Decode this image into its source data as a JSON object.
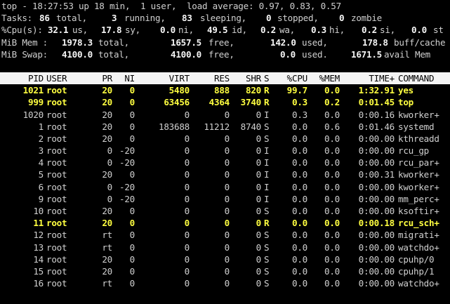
{
  "summary": {
    "line1": "top - 18:27:53 up 18 min,  1 user,  load average: 0.97, 0.83, 0.57",
    "tasks": {
      "label": "Tasks:",
      "total": "86",
      "total_lbl": "total,",
      "running": "3",
      "running_lbl": "running,",
      "sleeping": "83",
      "sleeping_lbl": "sleeping,",
      "stopped": "0",
      "stopped_lbl": "stopped,",
      "zombie": "0",
      "zombie_lbl": "zombie"
    },
    "cpu": {
      "label": "%Cpu(s):",
      "us": "32.1",
      "us_lbl": "us,",
      "sy": "17.8",
      "sy_lbl": "sy,",
      "ni": "0.0",
      "ni_lbl": "ni,",
      "id": "49.5",
      "id_lbl": "id,",
      "wa": "0.2",
      "wa_lbl": "wa,",
      "hi": "0.3",
      "hi_lbl": "hi,",
      "si": "0.2",
      "si_lbl": "si,",
      "st": "0.0",
      "st_lbl": "st"
    },
    "mem": {
      "label": "MiB Mem :",
      "total": "1978.3",
      "total_lbl": "total,",
      "free": "1657.5",
      "free_lbl": "free,",
      "used": "142.0",
      "used_lbl": "used,",
      "buff": "178.8",
      "buff_lbl": "buff/cache"
    },
    "swap": {
      "label": "MiB Swap:",
      "total": "4100.0",
      "total_lbl": "total,",
      "free": "4100.0",
      "free_lbl": "free,",
      "used": "0.0",
      "used_lbl": "used.",
      "avail": "1671.5",
      "avail_lbl": "avail Mem"
    }
  },
  "columns": [
    "PID",
    "USER",
    "PR",
    "NI",
    "VIRT",
    "RES",
    "SHR",
    "S",
    "%CPU",
    "%MEM",
    "TIME+",
    "COMMAND"
  ],
  "processes": [
    {
      "pid": "1021",
      "user": "root",
      "pr": "20",
      "ni": "0",
      "virt": "5480",
      "res": "888",
      "shr": "820",
      "s": "R",
      "cpu": "99.7",
      "mem": "0.0",
      "time": "1:32.91",
      "cmd": "yes",
      "hot": true
    },
    {
      "pid": "999",
      "user": "root",
      "pr": "20",
      "ni": "0",
      "virt": "63456",
      "res": "4364",
      "shr": "3740",
      "s": "R",
      "cpu": "0.3",
      "mem": "0.2",
      "time": "0:01.45",
      "cmd": "top",
      "hot": true
    },
    {
      "pid": "1020",
      "user": "root",
      "pr": "20",
      "ni": "0",
      "virt": "0",
      "res": "0",
      "shr": "0",
      "s": "I",
      "cpu": "0.3",
      "mem": "0.0",
      "time": "0:00.16",
      "cmd": "kworker+",
      "hot": false
    },
    {
      "pid": "1",
      "user": "root",
      "pr": "20",
      "ni": "0",
      "virt": "183688",
      "res": "11212",
      "shr": "8740",
      "s": "S",
      "cpu": "0.0",
      "mem": "0.6",
      "time": "0:01.46",
      "cmd": "systemd",
      "hot": false
    },
    {
      "pid": "2",
      "user": "root",
      "pr": "20",
      "ni": "0",
      "virt": "0",
      "res": "0",
      "shr": "0",
      "s": "S",
      "cpu": "0.0",
      "mem": "0.0",
      "time": "0:00.00",
      "cmd": "kthreadd",
      "hot": false
    },
    {
      "pid": "3",
      "user": "root",
      "pr": "0",
      "ni": "-20",
      "virt": "0",
      "res": "0",
      "shr": "0",
      "s": "I",
      "cpu": "0.0",
      "mem": "0.0",
      "time": "0:00.00",
      "cmd": "rcu_gp",
      "hot": false
    },
    {
      "pid": "4",
      "user": "root",
      "pr": "0",
      "ni": "-20",
      "virt": "0",
      "res": "0",
      "shr": "0",
      "s": "I",
      "cpu": "0.0",
      "mem": "0.0",
      "time": "0:00.00",
      "cmd": "rcu_par+",
      "hot": false
    },
    {
      "pid": "5",
      "user": "root",
      "pr": "20",
      "ni": "0",
      "virt": "0",
      "res": "0",
      "shr": "0",
      "s": "I",
      "cpu": "0.0",
      "mem": "0.0",
      "time": "0:00.31",
      "cmd": "kworker+",
      "hot": false
    },
    {
      "pid": "6",
      "user": "root",
      "pr": "0",
      "ni": "-20",
      "virt": "0",
      "res": "0",
      "shr": "0",
      "s": "I",
      "cpu": "0.0",
      "mem": "0.0",
      "time": "0:00.00",
      "cmd": "kworker+",
      "hot": false
    },
    {
      "pid": "9",
      "user": "root",
      "pr": "0",
      "ni": "-20",
      "virt": "0",
      "res": "0",
      "shr": "0",
      "s": "I",
      "cpu": "0.0",
      "mem": "0.0",
      "time": "0:00.00",
      "cmd": "mm_perc+",
      "hot": false
    },
    {
      "pid": "10",
      "user": "root",
      "pr": "20",
      "ni": "0",
      "virt": "0",
      "res": "0",
      "shr": "0",
      "s": "S",
      "cpu": "0.0",
      "mem": "0.0",
      "time": "0:00.00",
      "cmd": "ksoftir+",
      "hot": false
    },
    {
      "pid": "11",
      "user": "root",
      "pr": "20",
      "ni": "0",
      "virt": "0",
      "res": "0",
      "shr": "0",
      "s": "R",
      "cpu": "0.0",
      "mem": "0.0",
      "time": "0:00.18",
      "cmd": "rcu_sch+",
      "hot": true
    },
    {
      "pid": "12",
      "user": "root",
      "pr": "rt",
      "ni": "0",
      "virt": "0",
      "res": "0",
      "shr": "0",
      "s": "S",
      "cpu": "0.0",
      "mem": "0.0",
      "time": "0:00.00",
      "cmd": "migrati+",
      "hot": false
    },
    {
      "pid": "13",
      "user": "root",
      "pr": "rt",
      "ni": "0",
      "virt": "0",
      "res": "0",
      "shr": "0",
      "s": "S",
      "cpu": "0.0",
      "mem": "0.0",
      "time": "0:00.00",
      "cmd": "watchdo+",
      "hot": false
    },
    {
      "pid": "14",
      "user": "root",
      "pr": "20",
      "ni": "0",
      "virt": "0",
      "res": "0",
      "shr": "0",
      "s": "S",
      "cpu": "0.0",
      "mem": "0.0",
      "time": "0:00.00",
      "cmd": "cpuhp/0",
      "hot": false
    },
    {
      "pid": "15",
      "user": "root",
      "pr": "20",
      "ni": "0",
      "virt": "0",
      "res": "0",
      "shr": "0",
      "s": "S",
      "cpu": "0.0",
      "mem": "0.0",
      "time": "0:00.00",
      "cmd": "cpuhp/1",
      "hot": false
    },
    {
      "pid": "16",
      "user": "root",
      "pr": "rt",
      "ni": "0",
      "virt": "0",
      "res": "0",
      "shr": "0",
      "s": "S",
      "cpu": "0.0",
      "mem": "0.0",
      "time": "0:00.00",
      "cmd": "watchdo+",
      "hot": false
    }
  ]
}
